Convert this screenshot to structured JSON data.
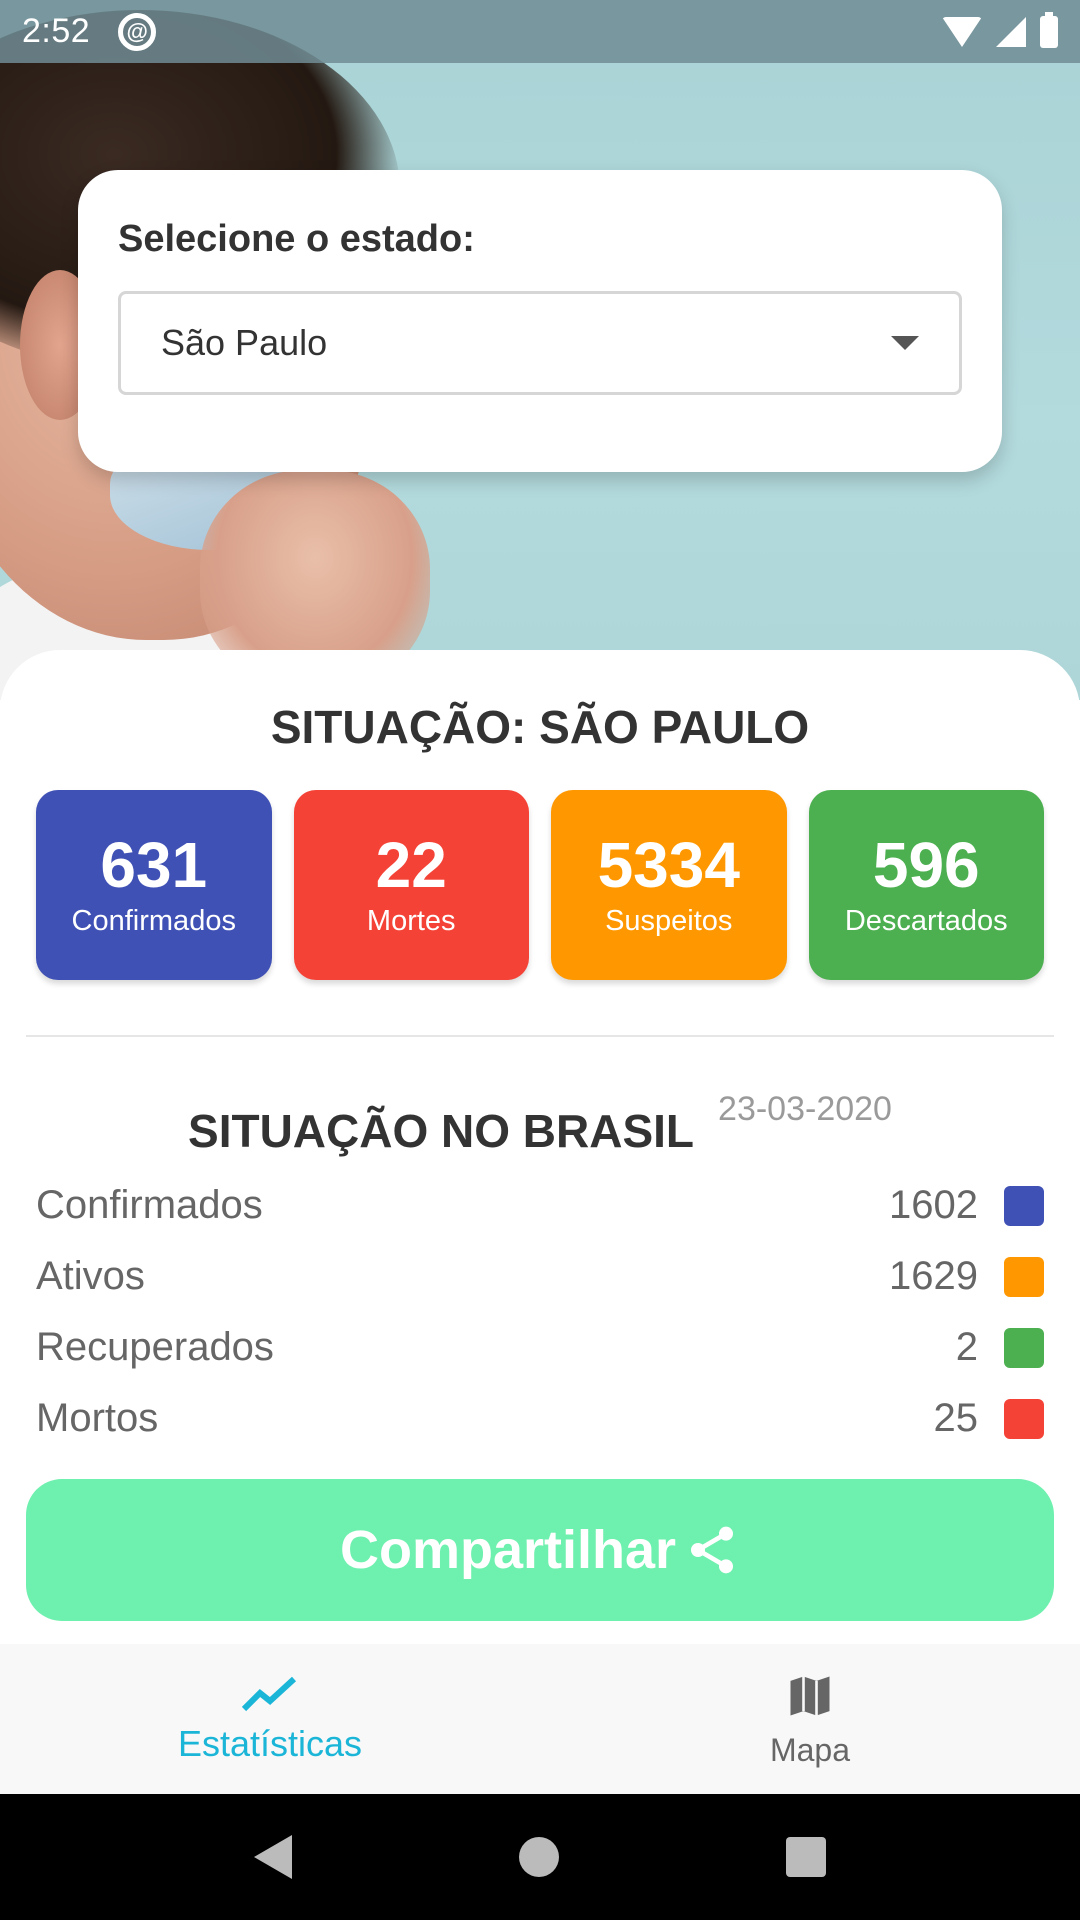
{
  "status_bar": {
    "time": "2:52"
  },
  "state_selector": {
    "label": "Selecione o estado:",
    "selected": "São Paulo"
  },
  "state_summary": {
    "title": "SITUAÇÃO: SÃO PAULO",
    "stats": [
      {
        "value": "631",
        "label": "Confirmados",
        "color": "#3f51b5"
      },
      {
        "value": "22",
        "label": "Mortes",
        "color": "#f44336"
      },
      {
        "value": "5334",
        "label": "Suspeitos",
        "color": "#ff9800"
      },
      {
        "value": "596",
        "label": "Descartados",
        "color": "#4caf50"
      }
    ]
  },
  "brazil": {
    "title": "SITUAÇÃO NO BRASIL",
    "date": "23-03-2020",
    "rows": [
      {
        "name": "Confirmados",
        "value": "1602",
        "color": "#3f51b5"
      },
      {
        "name": "Ativos",
        "value": "1629",
        "color": "#ff9800"
      },
      {
        "name": "Recuperados",
        "value": "2",
        "color": "#4caf50"
      },
      {
        "name": "Mortos",
        "value": "25",
        "color": "#f44336"
      }
    ]
  },
  "share_button": {
    "label": "Compartilhar",
    "icon": "share-icon"
  },
  "bottom_nav": {
    "items": [
      {
        "label": "Estatísticas",
        "icon": "trending-up-icon",
        "active": true
      },
      {
        "label": "Mapa",
        "icon": "map-icon",
        "active": false
      }
    ]
  }
}
